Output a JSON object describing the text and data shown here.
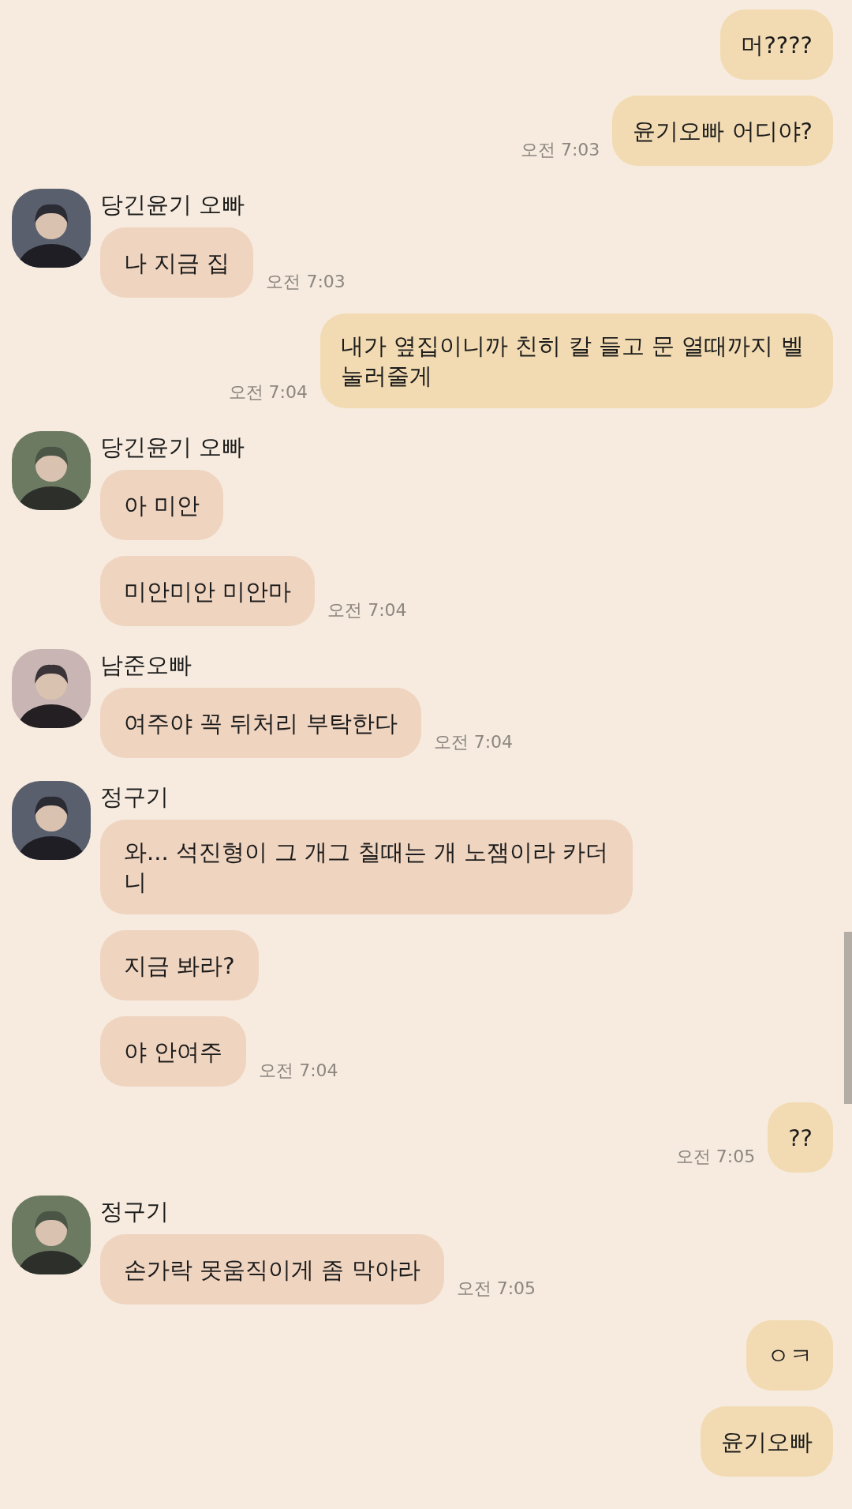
{
  "messages": [
    {
      "kind": "sent",
      "text": "머????"
    },
    {
      "kind": "sent",
      "text": "윤기오빠 어디야?",
      "time": "오전 7:03"
    },
    {
      "kind": "received",
      "sender": "당긴윤기 오빠",
      "bubbles": [
        {
          "text": "나 지금 집",
          "time": "오전 7:03"
        }
      ]
    },
    {
      "kind": "sent",
      "text": "내가 옆집이니까 친히 칼 들고 문 열때까지 벨 눌러줄게",
      "time": "오전 7:04"
    },
    {
      "kind": "received",
      "sender": "당긴윤기 오빠",
      "bubbles": [
        {
          "text": "아 미안"
        },
        {
          "text": "미안미안 미안마",
          "time": "오전 7:04"
        }
      ]
    },
    {
      "kind": "received",
      "sender": "남준오빠",
      "bubbles": [
        {
          "text": "여주야 꼭 뒤처리 부탁한다",
          "time": "오전 7:04"
        }
      ]
    },
    {
      "kind": "received",
      "sender": "정구기",
      "bubbles": [
        {
          "text": "와... 석진형이 그 개그 칠때는 개 노잼이라 카더니"
        },
        {
          "text": "지금 봐라?"
        },
        {
          "text": "야 안여주",
          "time": "오전 7:04"
        }
      ]
    },
    {
      "kind": "sent",
      "text": "??",
      "time": "오전 7:05"
    },
    {
      "kind": "received",
      "sender": "정구기",
      "bubbles": [
        {
          "text": "손가락 못움직이게 좀 막아라",
          "time": "오전 7:05"
        }
      ]
    },
    {
      "kind": "sent",
      "text": "ㅇㅋ"
    },
    {
      "kind": "sent",
      "text": "윤기오빠"
    }
  ]
}
